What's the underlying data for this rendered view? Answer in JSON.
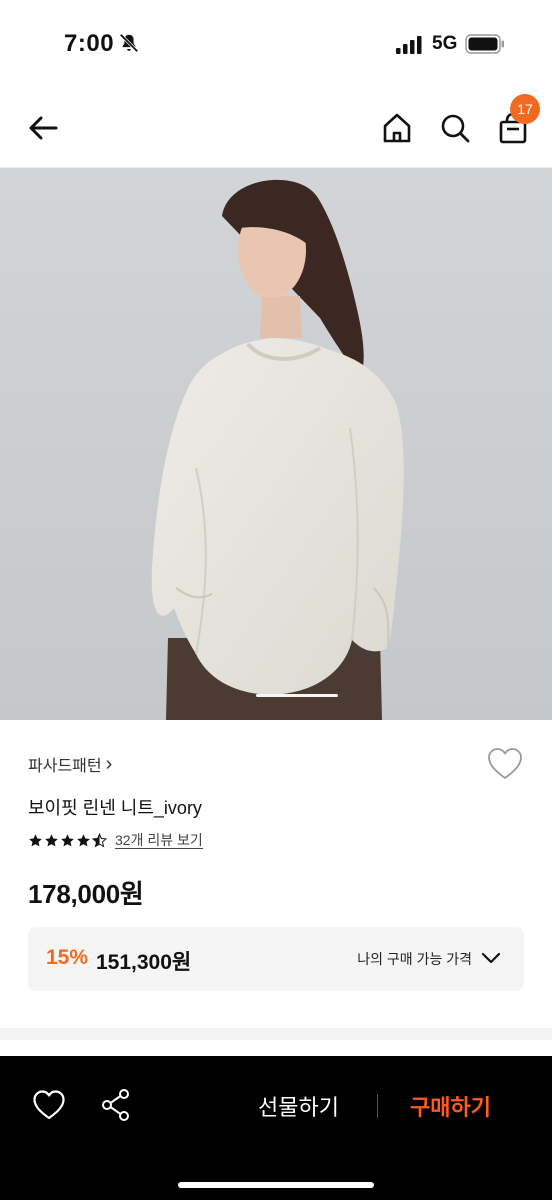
{
  "status": {
    "time": "7:00",
    "network": "5G"
  },
  "header": {
    "cart_count": "17"
  },
  "product": {
    "brand": "파사드패턴",
    "brand_chevron": "›",
    "title": "보이핏 린넨 니트_ivory",
    "rating": 4.5,
    "review_link": "32개 리뷰 보기",
    "price": "178,000원",
    "discount_rate": "15%",
    "discount_price": "151,300원",
    "my_price_label": "나의 구매 가능 가격"
  },
  "bottom_bar": {
    "gift_label": "선물하기",
    "buy_label": "구매하기"
  },
  "colors": {
    "accent": "#f26a21",
    "buy": "#ff5a1f",
    "bar": "#000000"
  }
}
